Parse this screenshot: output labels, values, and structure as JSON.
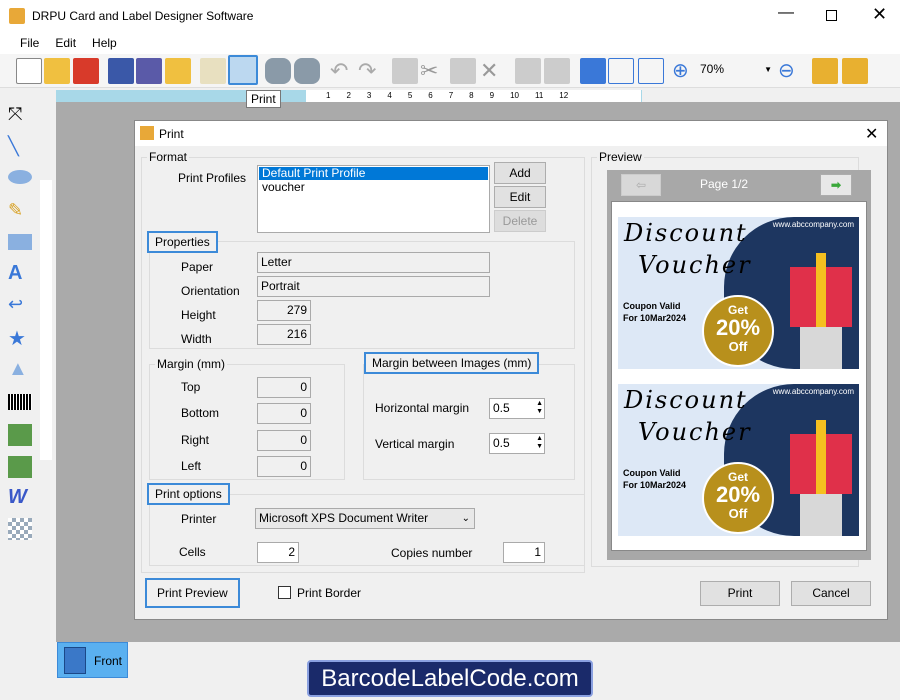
{
  "window": {
    "title": "DRPU Card and Label Designer Software"
  },
  "menu": [
    "File",
    "Edit",
    "Help"
  ],
  "toolbar": {
    "zoom_value": "70%",
    "tooltip": "Print"
  },
  "ruler_labels": [
    "1",
    "2",
    "3",
    "4",
    "5",
    "6",
    "7",
    "8",
    "9",
    "10",
    "11",
    "12"
  ],
  "dialog": {
    "title": "Print",
    "format_label": "Format",
    "print_profiles_label": "Print Profiles",
    "profiles": [
      "Default Print Profile",
      "voucher"
    ],
    "add": "Add",
    "edit": "Edit",
    "delete": "Delete",
    "properties_label": "Properties",
    "paper_label": "Paper",
    "paper": "Letter",
    "orientation_label": "Orientation",
    "orientation": "Portrait",
    "height_label": "Height",
    "height": "279",
    "width_label": "Width",
    "width": "216",
    "margin_label": "Margin (mm)",
    "top_label": "Top",
    "top": "0",
    "bottom_label": "Bottom",
    "bottom": "0",
    "right_label": "Right",
    "right": "0",
    "left_label": "Left",
    "left": "0",
    "margin_images_label": "Margin between Images (mm)",
    "hmargin_label": "Horizontal margin",
    "hmargin": "0.5",
    "vmargin_label": "Vertical margin",
    "vmargin": "0.5",
    "print_options_label": "Print options",
    "printer_label": "Printer",
    "printer": "Microsoft XPS Document Writer",
    "cells_label": "Cells",
    "cells": "2",
    "copies_label": "Copies number",
    "copies": "1",
    "print_preview": "Print Preview",
    "print_border": "Print Border",
    "print": "Print",
    "cancel": "Cancel",
    "preview_label": "Preview",
    "page": "Page 1/2"
  },
  "voucher": {
    "line1": "Discount",
    "line2": "Voucher",
    "url": "www.abccompany.com",
    "valid1": "Coupon Valid",
    "valid2": "For 10Mar2024",
    "get": "Get",
    "pct": "20%",
    "off": "Off"
  },
  "tabs": {
    "front": "Front"
  },
  "banner": "BarcodeLabelCode.com",
  "colors": {
    "accent": "#3c8ad8",
    "navy": "#1d3660",
    "gold": "#b8901c",
    "selection": "#0078d7"
  }
}
